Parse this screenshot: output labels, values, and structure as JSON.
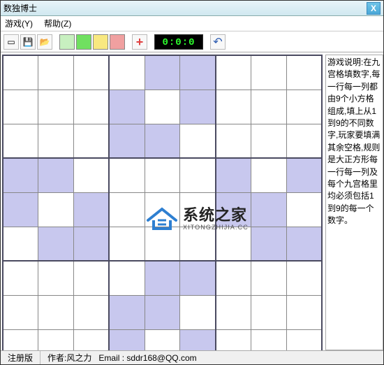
{
  "window": {
    "title": "数独博士"
  },
  "menu": {
    "game": "游戏(Y)",
    "help": "帮助(Z)"
  },
  "toolbar": {
    "new_tip": "新建",
    "open_tip": "打开",
    "save_tip": "保存",
    "timer": "0:0:0",
    "undo_tip": "撤销"
  },
  "grid": {
    "shaded": [
      [
        0,
        4
      ],
      [
        0,
        5
      ],
      [
        1,
        3
      ],
      [
        1,
        5
      ],
      [
        2,
        3
      ],
      [
        2,
        4
      ],
      [
        3,
        0
      ],
      [
        3,
        1
      ],
      [
        3,
        6
      ],
      [
        3,
        8
      ],
      [
        4,
        0
      ],
      [
        4,
        2
      ],
      [
        4,
        6
      ],
      [
        4,
        7
      ],
      [
        5,
        1
      ],
      [
        5,
        2
      ],
      [
        5,
        7
      ],
      [
        5,
        8
      ],
      [
        6,
        4
      ],
      [
        6,
        5
      ],
      [
        7,
        3
      ],
      [
        7,
        4
      ],
      [
        8,
        3
      ],
      [
        8,
        5
      ]
    ]
  },
  "instructions": "游戏说明:在九宫格填数字,每一行每一列都由9个小方格组成,填上从1到9的不同数字,玩家要填满其余空格,规则是大正方形每一行每一列及每个九宫格里均必须包括1到9的每一个数字。",
  "watermark": {
    "cn": "系统之家",
    "en": "XITONGZHIJIA.CC"
  },
  "status": {
    "edition": "注册版",
    "author_label": "作者:",
    "author_name": "风之力",
    "email_label": "Email :",
    "email": "sddr168@QQ.com"
  }
}
